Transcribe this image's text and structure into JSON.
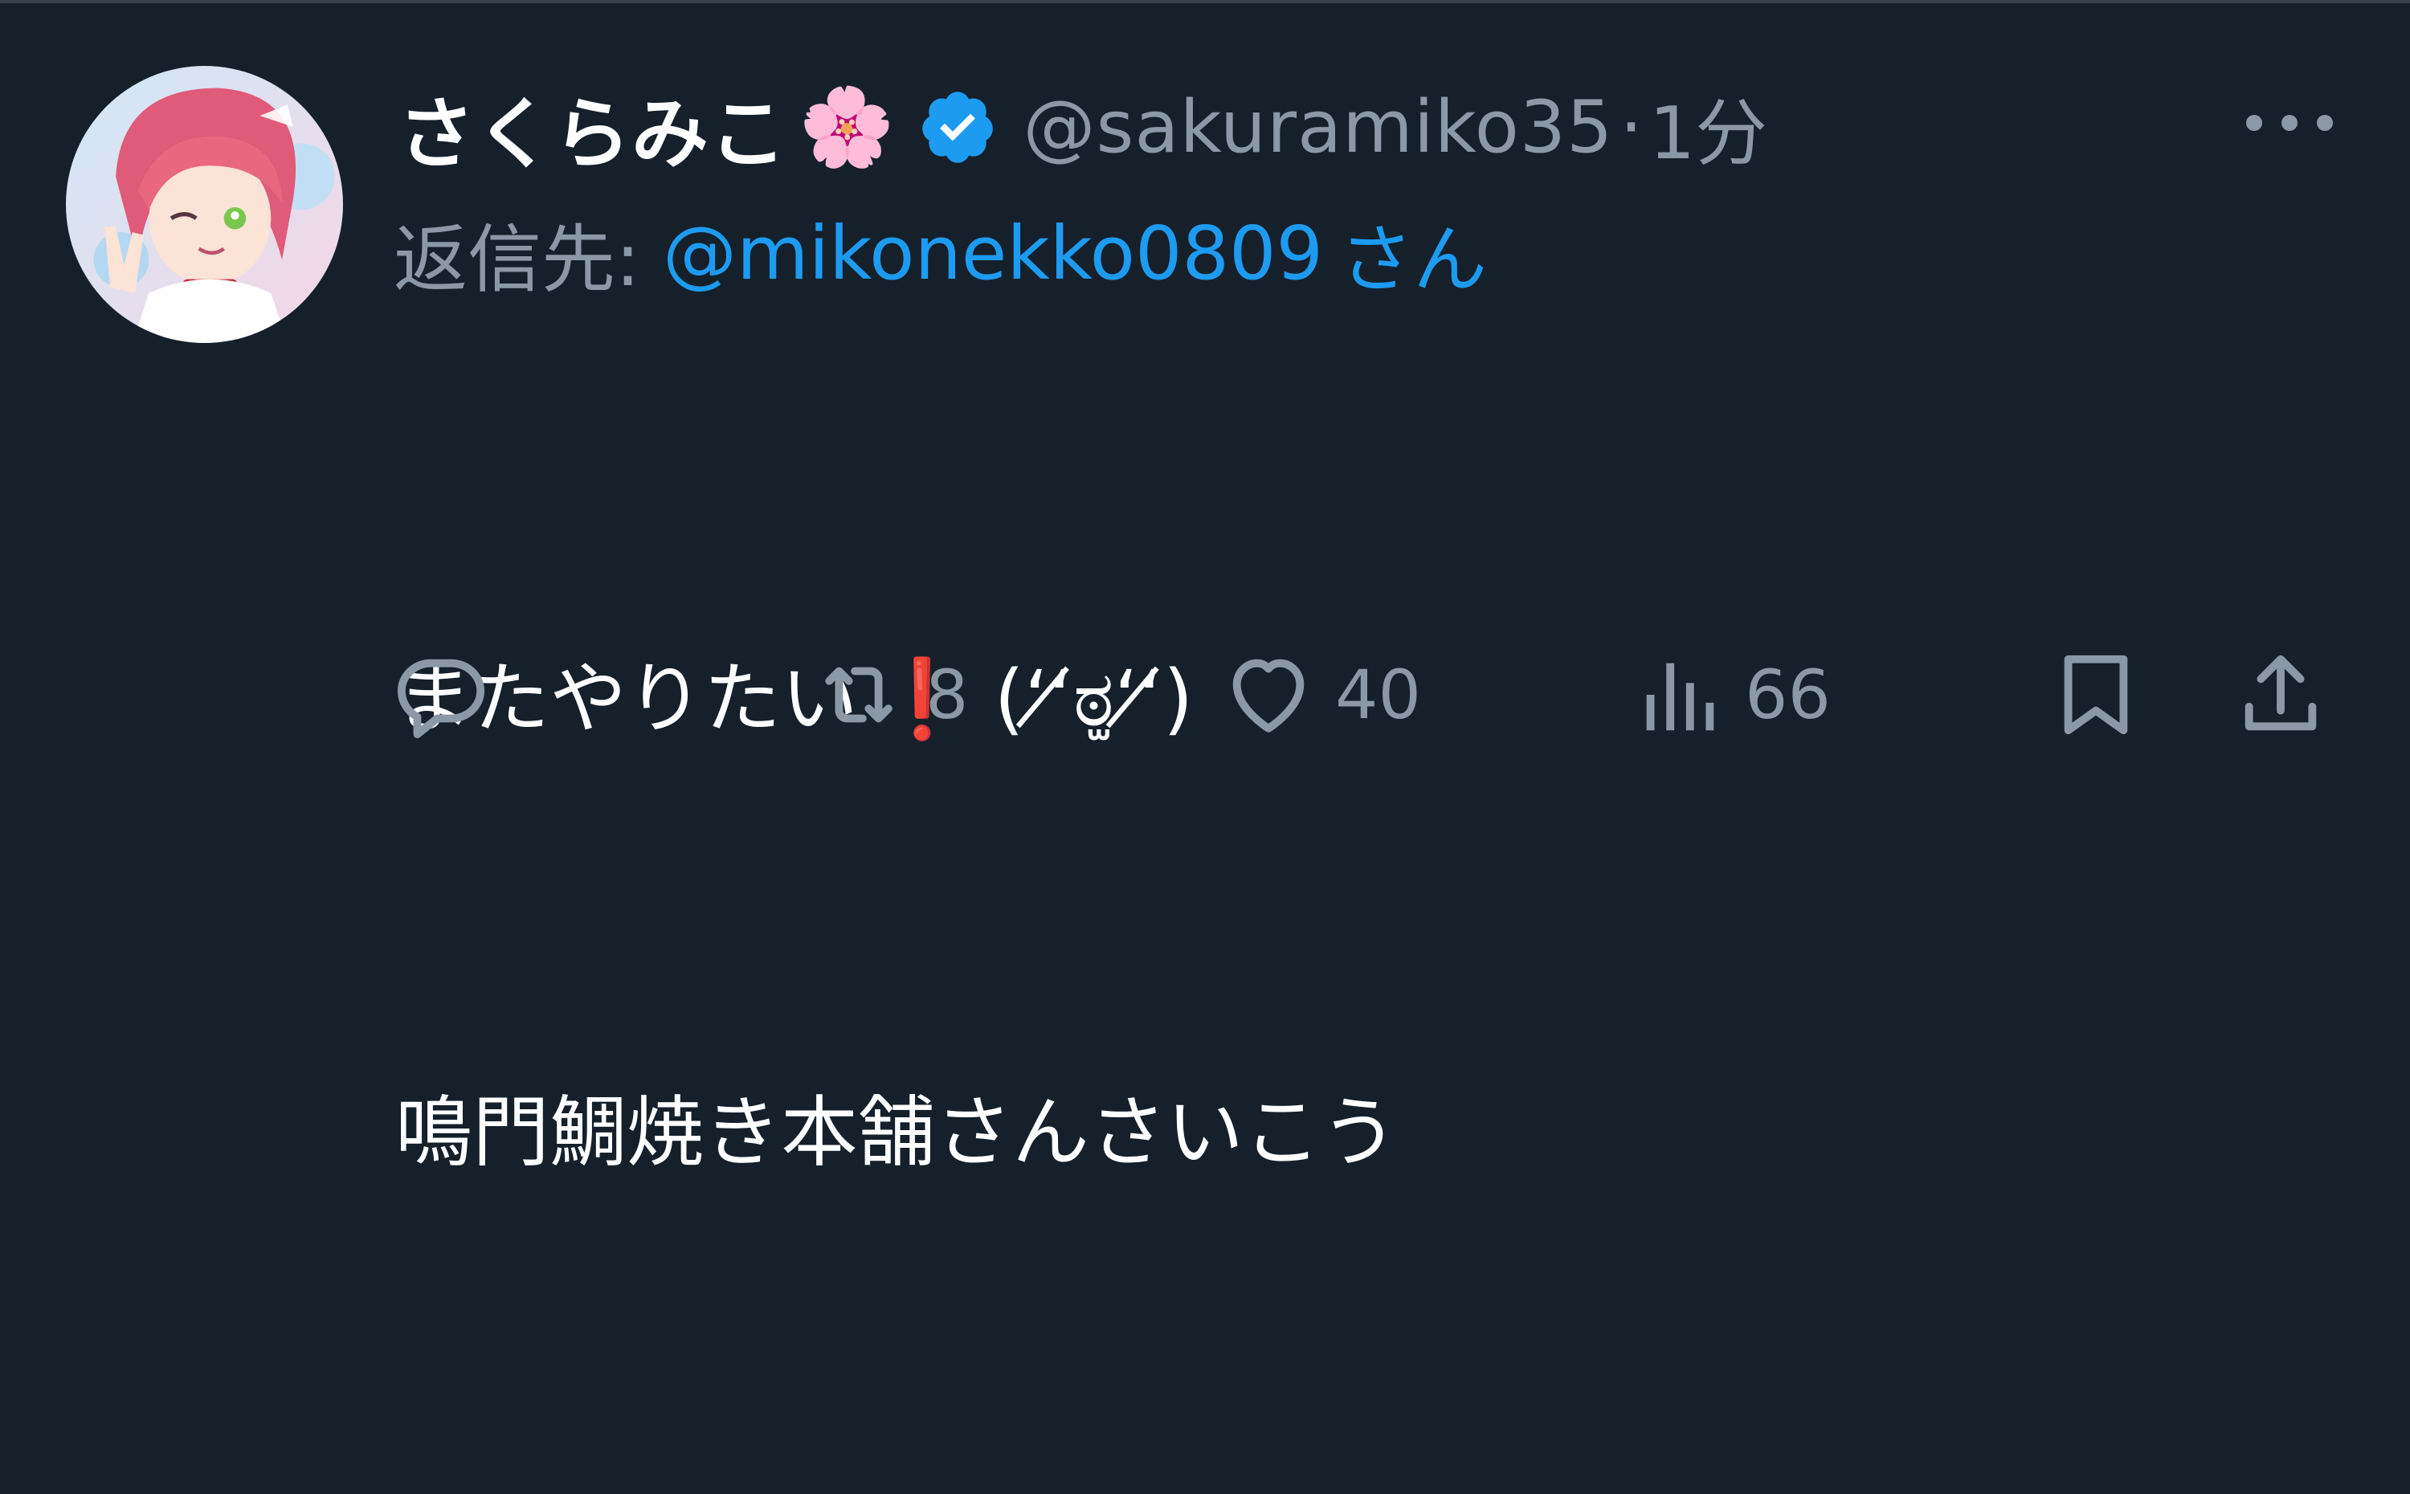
{
  "tweet": {
    "display_name": "さくらみこ",
    "name_emoji": "🌸",
    "handle": "@sakuramiko35",
    "separator": "·",
    "timestamp": "1分",
    "reply_prefix": "返信先:",
    "reply_mention": "@mikonekko0809",
    "reply_suffix": "さん",
    "body_line1_start": "またやりたい",
    "body_line1_exclaim": "❗",
    "body_line1_end": "(ʻʻ̸ಠ̫ʻʻ̸)",
    "body_line2": "鳴門鯛焼き本舗さんさいこう"
  },
  "actions": {
    "reply_count": "",
    "retweet_count": "8",
    "like_count": "40",
    "views_count": "66"
  },
  "colors": {
    "background": "#15202b",
    "text_primary": "#ffffff",
    "text_secondary": "#8b98a5",
    "link": "#1d9bf0",
    "verified": "#1d9bf0",
    "exclaim": "#e0245e"
  },
  "icons": {
    "verified": "verified-badge-icon",
    "more": "more-dots-icon",
    "reply": "reply-bubble-icon",
    "retweet": "retweet-icon",
    "like": "heart-icon",
    "views": "views-bars-icon",
    "bookmark": "bookmark-icon",
    "share": "share-icon"
  }
}
